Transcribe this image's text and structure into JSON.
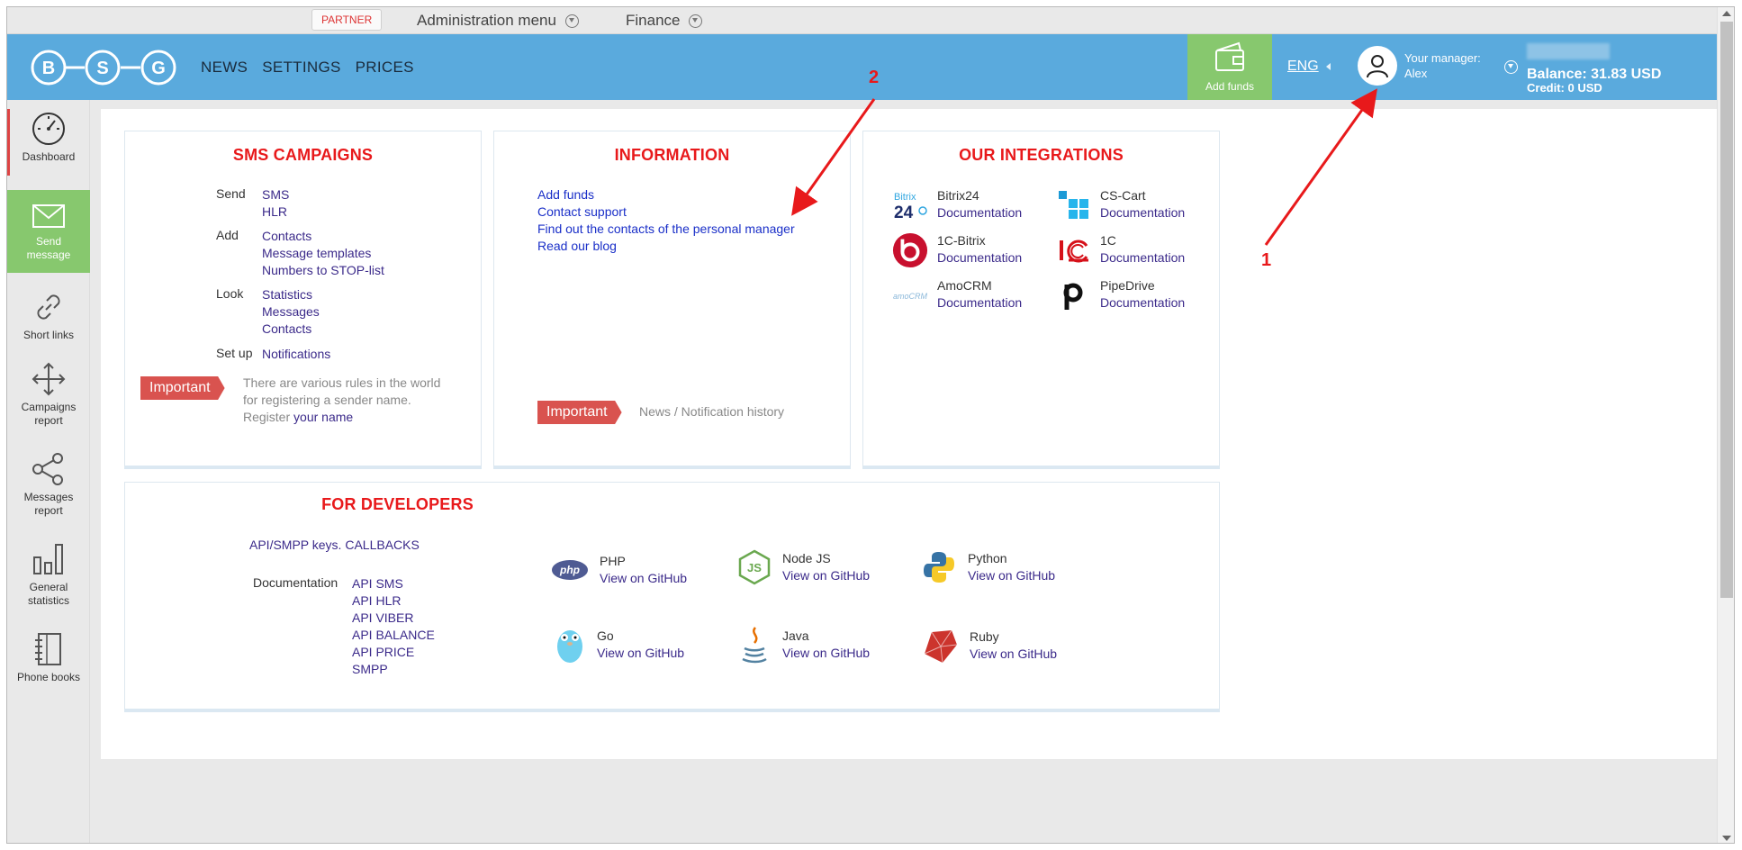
{
  "adminbar": {
    "partner": "PARTNER",
    "admin_menu": "Administration menu",
    "finance": "Finance"
  },
  "header": {
    "logo_letters": [
      "B",
      "S",
      "G"
    ],
    "nav": [
      "NEWS",
      "SETTINGS",
      "PRICES"
    ],
    "add_funds": "Add funds",
    "lang": "ENG",
    "manager_label": "Your manager:",
    "manager_name": "Alex",
    "balance": "Balance: 31.83 USD",
    "credit": "Credit: 0 USD"
  },
  "sidebar": {
    "items": [
      {
        "label": "Dashboard",
        "icon": "speedometer-icon"
      },
      {
        "label": "Send message",
        "icon": "envelope-icon"
      },
      {
        "label": "Short links",
        "icon": "link-icon"
      },
      {
        "label": "Campaigns report",
        "icon": "move-arrows-icon"
      },
      {
        "label": "Messages report",
        "icon": "share-icon"
      },
      {
        "label": "General statistics",
        "icon": "bar-chart-icon"
      },
      {
        "label": "Phone books",
        "icon": "notebook-icon"
      }
    ]
  },
  "sms": {
    "title": "SMS CAMPAIGNS",
    "send_label": "Send",
    "send_links": [
      "SMS",
      "HLR"
    ],
    "add_label": "Add",
    "add_links": [
      "Contacts",
      "Message templates",
      "Numbers to STOP-list"
    ],
    "look_label": "Look",
    "look_links": [
      "Statistics",
      "Messages",
      "Contacts"
    ],
    "setup_label": "Set up",
    "setup_links": [
      "Notifications"
    ],
    "important": "Important",
    "note_line1": "There are various rules in the world",
    "note_line2": "for registering a sender name.",
    "note_line3_prefix": "Register",
    "note_line3_link": "your name"
  },
  "info": {
    "title": "INFORMATION",
    "links": [
      "Add funds",
      "Contact support",
      "Find out the contacts of the personal manager",
      "Read our blog"
    ],
    "important": "Important",
    "news": "News / Notification history"
  },
  "integrations": {
    "title": "OUR INTEGRATIONS",
    "items": [
      {
        "name": "Bitrix24",
        "doc": "Documentation",
        "icon": "bitrix24-icon"
      },
      {
        "name": "CS-Cart",
        "doc": "Documentation",
        "icon": "cscart-icon"
      },
      {
        "name": "1C-Bitrix",
        "doc": "Documentation",
        "icon": "1c-bitrix-icon"
      },
      {
        "name": "1C",
        "doc": "Documentation",
        "icon": "1c-icon"
      },
      {
        "name": "AmoCRM",
        "doc": "Documentation",
        "icon": "amocrm-icon"
      },
      {
        "name": "PipeDrive",
        "doc": "Documentation",
        "icon": "pipedrive-icon"
      }
    ],
    "bitrix_logo_text": "Bitrix",
    "bitrix_logo_num": "24",
    "amocrm_logo_text": "amoCRM"
  },
  "developers": {
    "title": "FOR DEVELOPERS",
    "keys_link": "API/SMPP keys. CALLBACKS",
    "doc_label": "Documentation",
    "doc_links": [
      "API SMS",
      "API HLR",
      "API VIBER",
      "API BALANCE",
      "API PRICE",
      "SMPP"
    ],
    "sdks": [
      {
        "name": "PHP",
        "gh": "View on GitHub",
        "icon": "php-icon"
      },
      {
        "name": "Node JS",
        "gh": "View on GitHub",
        "icon": "nodejs-icon"
      },
      {
        "name": "Python",
        "gh": "View on GitHub",
        "icon": "python-icon"
      },
      {
        "name": "Go",
        "gh": "View on GitHub",
        "icon": "go-gopher-icon"
      },
      {
        "name": "Java",
        "gh": "View on GitHub",
        "icon": "java-icon"
      },
      {
        "name": "Ruby",
        "gh": "View on GitHub",
        "icon": "ruby-icon"
      }
    ],
    "php_logo": "php"
  },
  "annotations": {
    "num1": "1",
    "num2": "2"
  },
  "colors": {
    "header": "#5aaadd",
    "green": "#87c86e",
    "title_red": "#e8191b",
    "link": "#3b2a8a",
    "important": "#d9534f"
  }
}
